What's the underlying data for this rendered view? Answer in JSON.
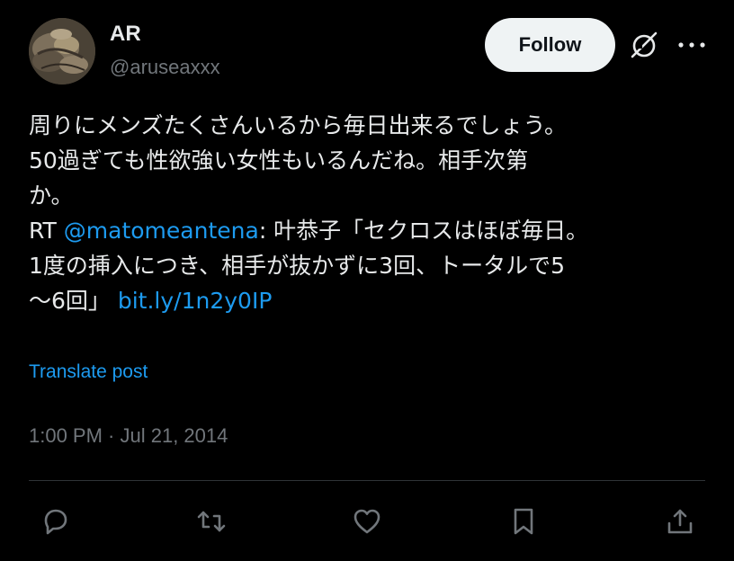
{
  "user": {
    "display_name": "AR",
    "handle": "@aruseaxxx",
    "avatar_icon": "avatar-photo"
  },
  "header": {
    "follow_label": "Follow",
    "grok_icon": "grok-icon",
    "more_icon": "more-icon"
  },
  "tweet": {
    "line1": "周りにメンズたくさんいるから毎日出来るでしょう。",
    "line2": "50過ぎても性欲強い女性もいるんだね。相手次第",
    "line3": "か。",
    "line4_prefix": "RT ",
    "line4_mention": "@matomeantena",
    "line4_suffix": ": 叶恭子「セクロスはほぼ毎日。",
    "line5": "1度の挿入につき、相手が抜かずに3回、トータルで5",
    "line6_prefix": "〜6回」 ",
    "line6_link": "bit.ly/1n2y0IP"
  },
  "translate_label": "Translate post",
  "timestamp": "1:00 PM · Jul 21, 2014",
  "actions": {
    "reply_icon": "reply-icon",
    "retweet_icon": "retweet-icon",
    "like_icon": "heart-icon",
    "bookmark_icon": "bookmark-icon",
    "share_icon": "share-icon"
  },
  "colors": {
    "background": "#000000",
    "text": "#e7e9ea",
    "secondary": "#71767b",
    "link": "#1d9bf0",
    "follow_bg": "#eff3f4"
  }
}
